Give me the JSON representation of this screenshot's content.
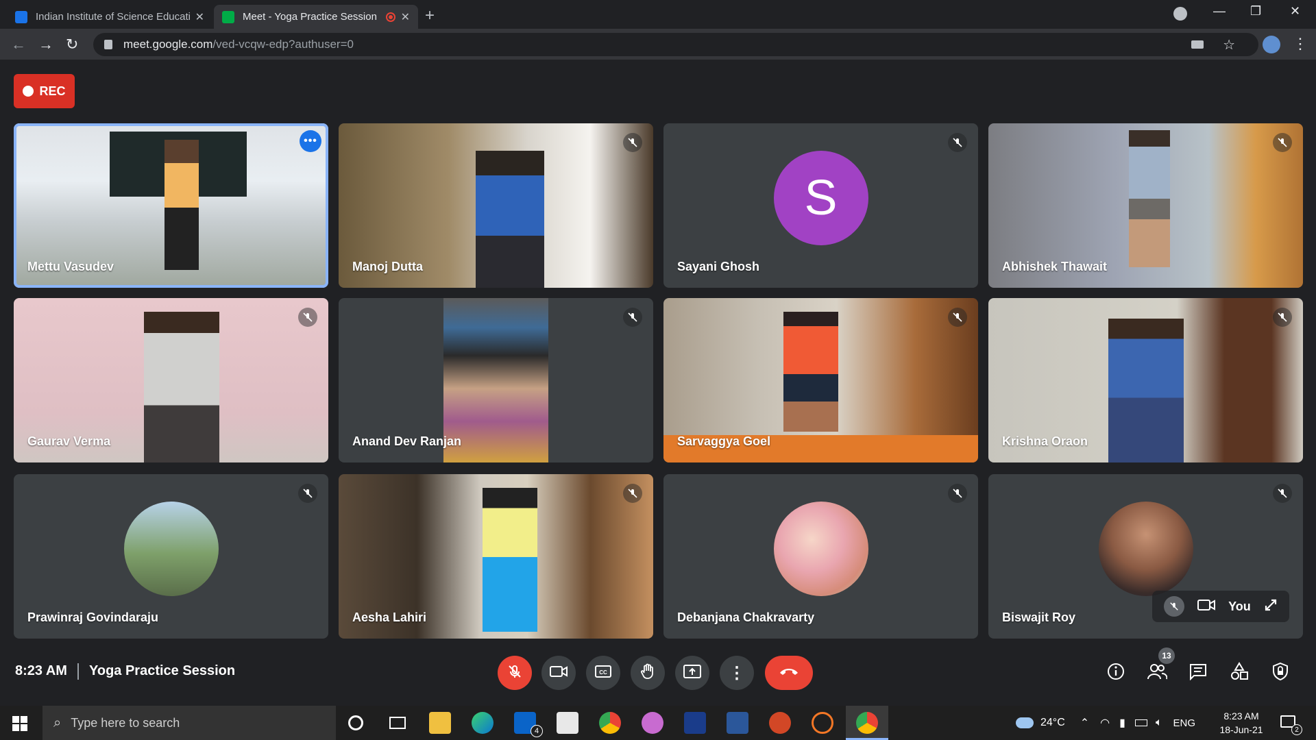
{
  "browser": {
    "tabs": [
      {
        "title": "Indian Institute of Science Educati",
        "fav_color": "#1a73e8"
      },
      {
        "title": "Meet - Yoga Practice Session",
        "fav_color": "#00ac47"
      }
    ],
    "url_host": "meet.google.com",
    "url_path": "/ved-vcqw-edp?authuser=0"
  },
  "rec_label": "REC",
  "participants": [
    {
      "name": "Mettu Vasudev"
    },
    {
      "name": "Manoj Dutta"
    },
    {
      "name": "Sayani Ghosh",
      "initial": "S",
      "avatar_color": "#a142c4"
    },
    {
      "name": "Abhishek Thawait"
    },
    {
      "name": "Gaurav Verma"
    },
    {
      "name": "Anand Dev Ranjan"
    },
    {
      "name": "Sarvaggya Goel"
    },
    {
      "name": "Krishna Oraon"
    },
    {
      "name": "Prawinraj Govindaraju"
    },
    {
      "name": "Aesha Lahiri"
    },
    {
      "name": "Debanjana Chakravarty"
    },
    {
      "name": "Biswajit Roy"
    }
  ],
  "self_label": "You",
  "meeting": {
    "time": "8:23 AM",
    "title": "Yoga Practice Session"
  },
  "people_count": "13",
  "taskbar": {
    "search_placeholder": "Type here to search",
    "mail_badge": "4",
    "weather": "24°C",
    "lang": "ENG",
    "clock_time": "8:23 AM",
    "clock_date": "18-Jun-21",
    "notif_count": "2"
  }
}
